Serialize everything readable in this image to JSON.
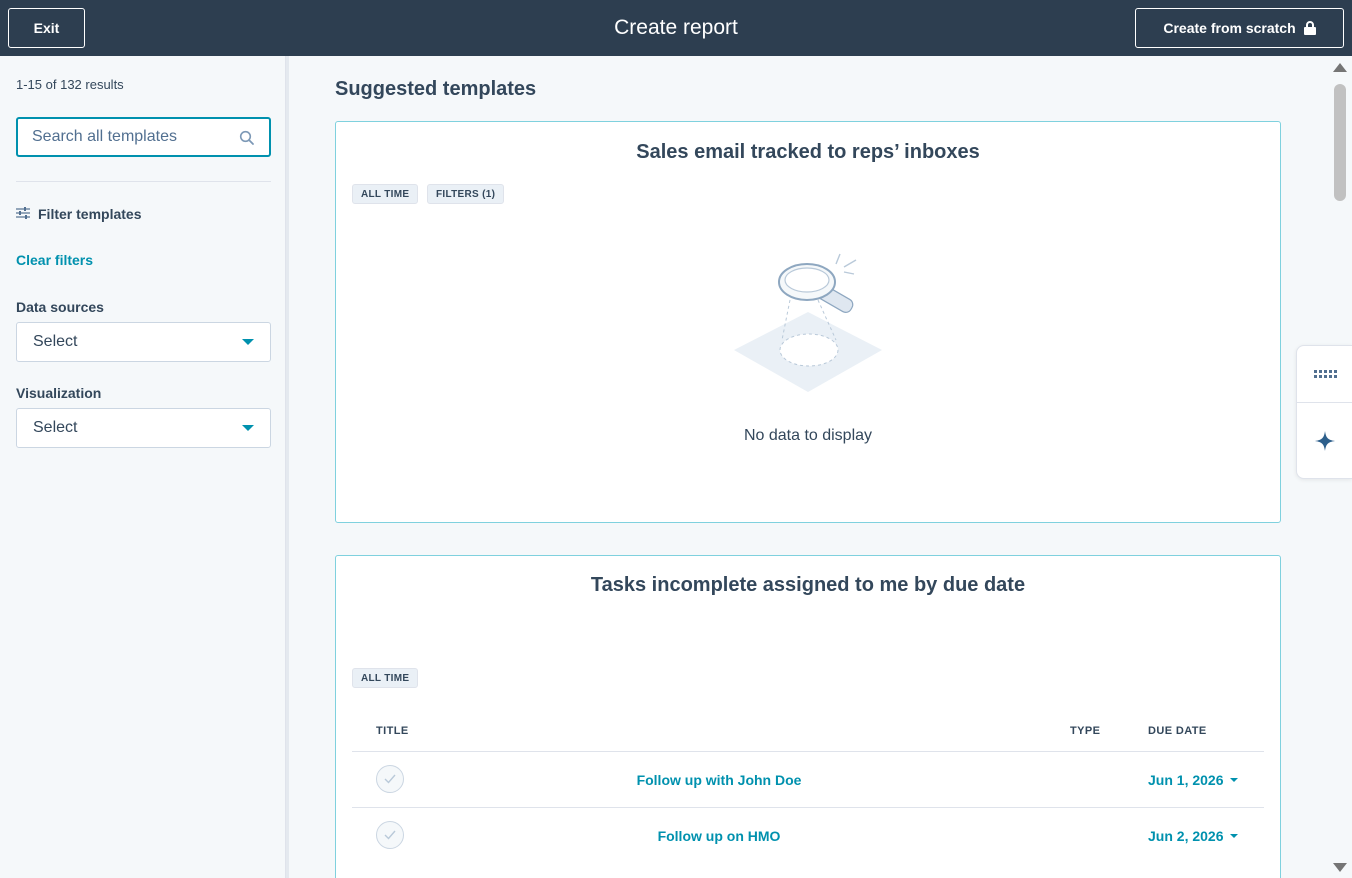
{
  "header": {
    "exit_label": "Exit",
    "title": "Create report",
    "create_label": "Create from scratch",
    "create_icon": "lock-icon"
  },
  "sidebar": {
    "results_count": "1-15 of 132 results",
    "search_placeholder": "Search all templates",
    "filter_heading": "Filter templates",
    "clear_filters": "Clear filters",
    "data_sources_label": "Data sources",
    "data_sources_value": "Select",
    "visualization_label": "Visualization",
    "visualization_value": "Select"
  },
  "main": {
    "section_title": "Suggested templates",
    "cards": [
      {
        "title": "Sales email tracked to reps’ inboxes",
        "tags": [
          "ALL TIME",
          "FILTERS (1)"
        ],
        "empty_message": "No data to display"
      },
      {
        "title": "Tasks incomplete assigned to me by due date",
        "tags": [
          "ALL TIME"
        ],
        "columns": [
          "TITLE",
          "TYPE",
          "DUE DATE"
        ],
        "rows": [
          {
            "title": "Follow up with John Doe",
            "type": "",
            "due_date": "Jun 1, 2026"
          },
          {
            "title": "Follow up on HMO",
            "type": "",
            "due_date": "Jun 2, 2026"
          }
        ]
      }
    ]
  },
  "colors": {
    "header_bg": "#2d3e50",
    "accent": "#0091ae",
    "text": "#33475b",
    "page_bg": "#f5f8fa"
  }
}
